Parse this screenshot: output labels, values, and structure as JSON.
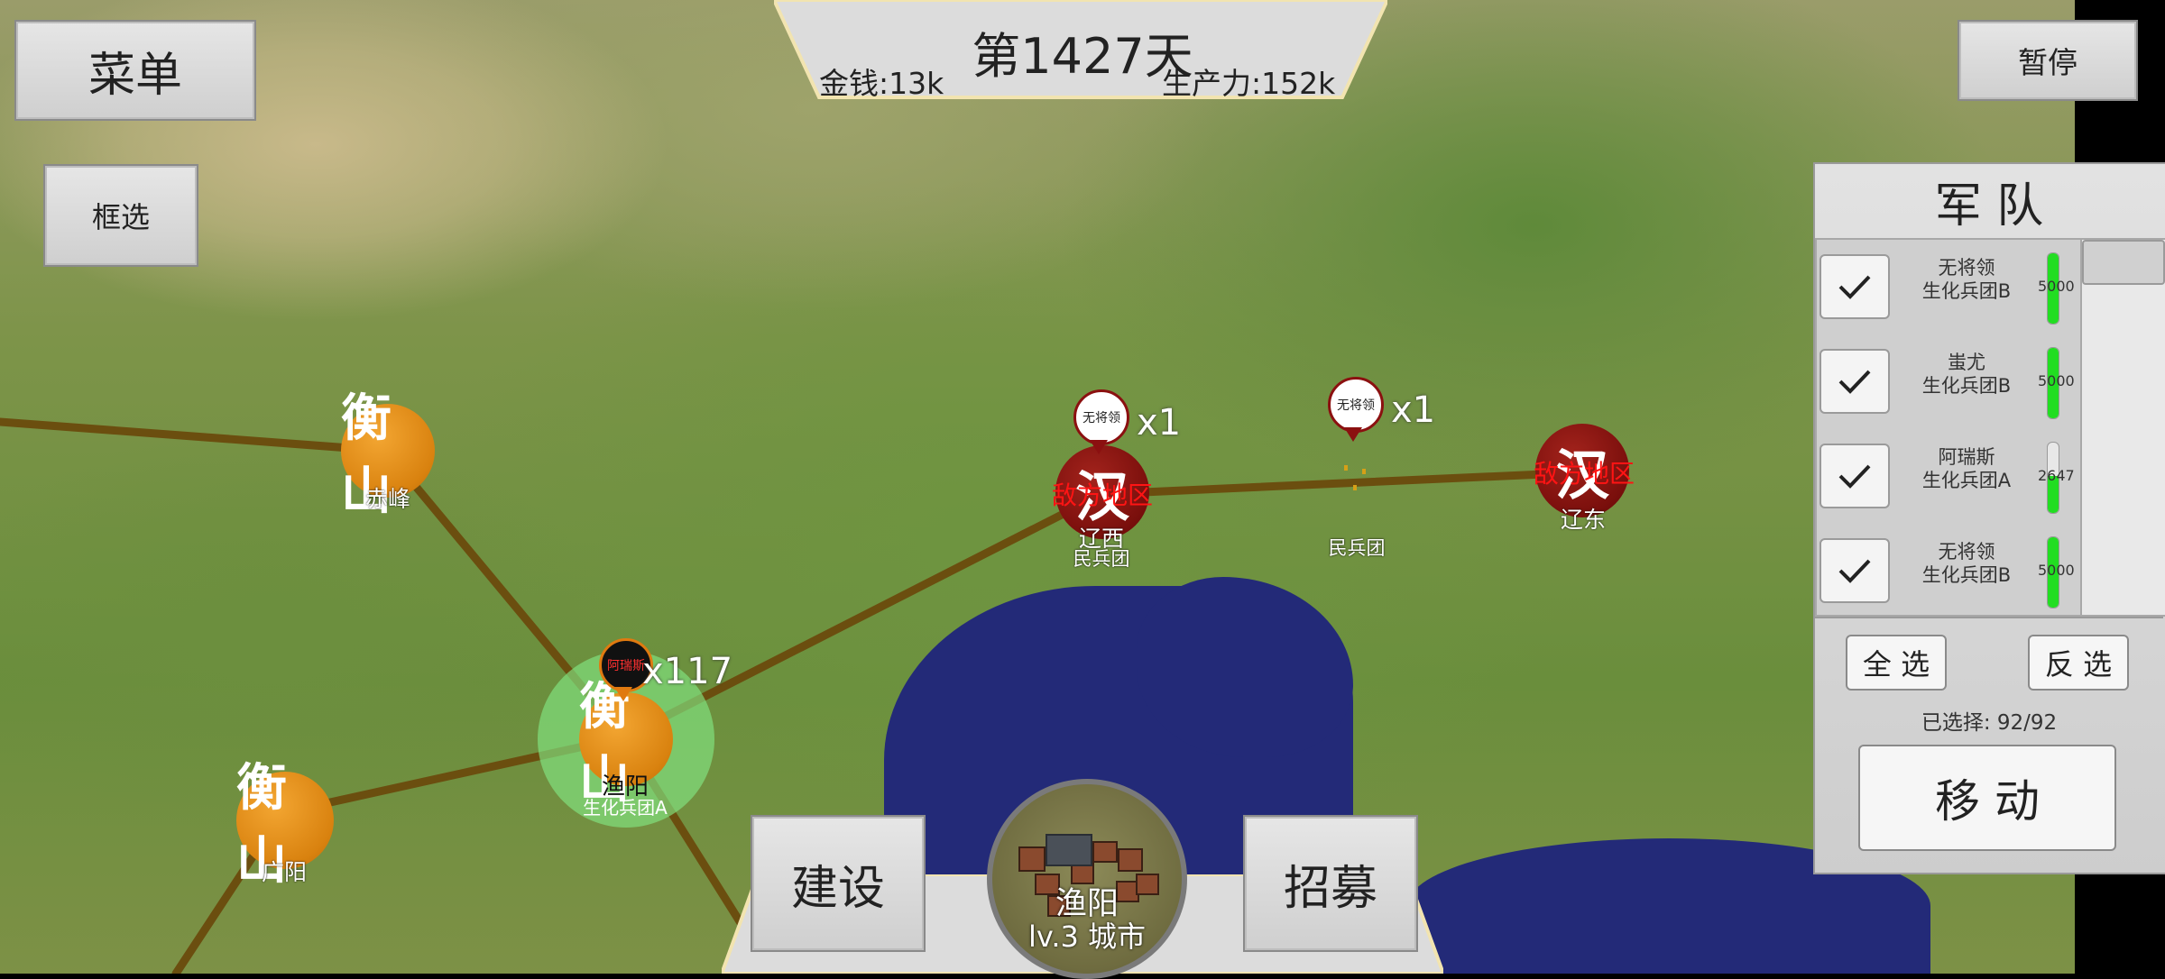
{
  "top": {
    "menu_label": "菜单",
    "box_select_label": "框选",
    "day_title": "第1427天",
    "money": "金钱:13k",
    "production": "生产力:152k",
    "pause_label": "暂停"
  },
  "cities": [
    {
      "glyph": "衡山",
      "name": "赤峰",
      "color": "orange"
    },
    {
      "glyph": "衡山",
      "name": "渔阳",
      "sub": "生化兵团A",
      "color": "orange"
    },
    {
      "glyph": "衡山",
      "name": "广阳",
      "color": "orange"
    },
    {
      "glyph": "汉",
      "name": "辽西",
      "sub": "民兵团",
      "enemy": "敌方地区",
      "color": "red"
    },
    {
      "glyph": "汉",
      "name": "辽东",
      "enemy": "敌方地区",
      "color": "red"
    }
  ],
  "units": [
    {
      "pin": "无将领",
      "count": "x1"
    },
    {
      "pin": "无将领",
      "count": "x1",
      "sub": "民兵团"
    },
    {
      "pin": "阿瑞斯",
      "count": "x117"
    }
  ],
  "army_panel": {
    "title": "军 队",
    "rows": [
      {
        "line1": "无将领",
        "line2": "生化兵团B",
        "hp": "5000",
        "hp_fraction": 1.0
      },
      {
        "line1": "蚩尤",
        "line2": "生化兵团B",
        "hp": "5000",
        "hp_fraction": 1.0
      },
      {
        "line1": "阿瑞斯",
        "line2": "生化兵团A",
        "hp": "2647",
        "hp_fraction": 0.53
      },
      {
        "line1": "无将领",
        "line2": "生化兵团B",
        "hp": "5000",
        "hp_fraction": 1.0
      }
    ],
    "select_all": "全 选",
    "invert_select": "反 选",
    "selected_count": "已选择: 92/92",
    "move_label": "移 动"
  },
  "bottom": {
    "build_label": "建设",
    "recruit_label": "招募",
    "city_name": "渔阳",
    "city_level": "lv.3 城市"
  },
  "colors": {
    "road": "#6b4e0f",
    "sea": "#232a78",
    "hp_green": "#22dd22",
    "enemy_red": "#ff1414"
  }
}
